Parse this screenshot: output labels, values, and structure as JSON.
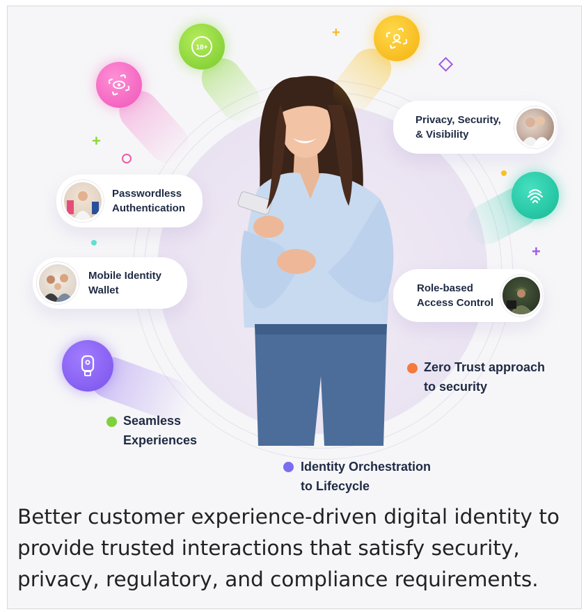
{
  "cards": {
    "privacy": {
      "line1": "Privacy, Security,",
      "line2": "& Visibility"
    },
    "passwordless": {
      "line1": "Passwordless",
      "line2": "Authentication"
    },
    "wallet": {
      "line1": "Mobile Identity",
      "line2": "Wallet"
    },
    "role": {
      "line1": "Role-based",
      "line2": "Access Control"
    }
  },
  "labels": {
    "zero_trust": {
      "line1": "Zero Trust approach",
      "line2": "to security",
      "dot_color": "#f5793b"
    },
    "seamless": {
      "line1": "Seamless",
      "line2": "Experiences",
      "dot_color": "#7fd13b"
    },
    "orchestration": {
      "line1": "Identity Orchestration",
      "line2": "to Lifecycle",
      "dot_color": "#7b6cf0"
    }
  },
  "badges": {
    "age_badge_text": "18+",
    "colors": {
      "green": "#8bd83a",
      "yellow": "#f9c11e",
      "pink": "#f56cc4",
      "teal": "#22c6a6",
      "violet": "#8a63f0"
    }
  },
  "caption": "Better customer experience-driven digital identity to provide trusted interactions that satisfy security, privacy, regulatory, and compliance requirements."
}
